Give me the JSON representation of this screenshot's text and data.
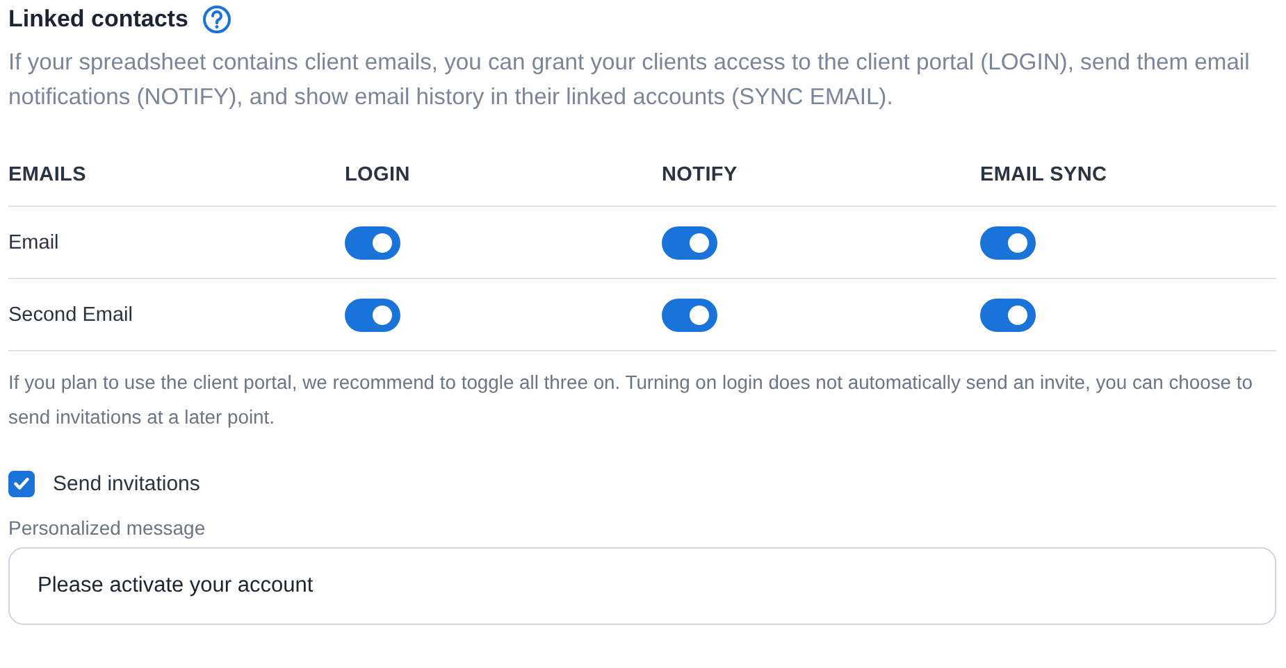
{
  "section": {
    "title": "Linked contacts",
    "description": "If your spreadsheet contains client emails, you can grant your clients access to the client portal (LOGIN), send them email notifications (NOTIFY), and show email history in their linked accounts (SYNC EMAIL)."
  },
  "table": {
    "columns": [
      "EMAILS",
      "LOGIN",
      "NOTIFY",
      "EMAIL SYNC"
    ],
    "rows": [
      {
        "label": "Email",
        "toggles": [
          {
            "on": true
          },
          {
            "on": true
          },
          {
            "on": true
          }
        ]
      },
      {
        "label": "Second Email",
        "toggles": [
          {
            "on": true
          },
          {
            "on": true
          },
          {
            "on": true
          }
        ]
      }
    ]
  },
  "note": "If you plan to use the client portal, we recommend to toggle all three on. Turning on login does not automatically send an invite, you can choose to send invitations at a later point.",
  "send_invitations": {
    "label": "Send invitations",
    "checked": true
  },
  "message": {
    "label": "Personalized message",
    "value": "Please activate your account"
  }
}
